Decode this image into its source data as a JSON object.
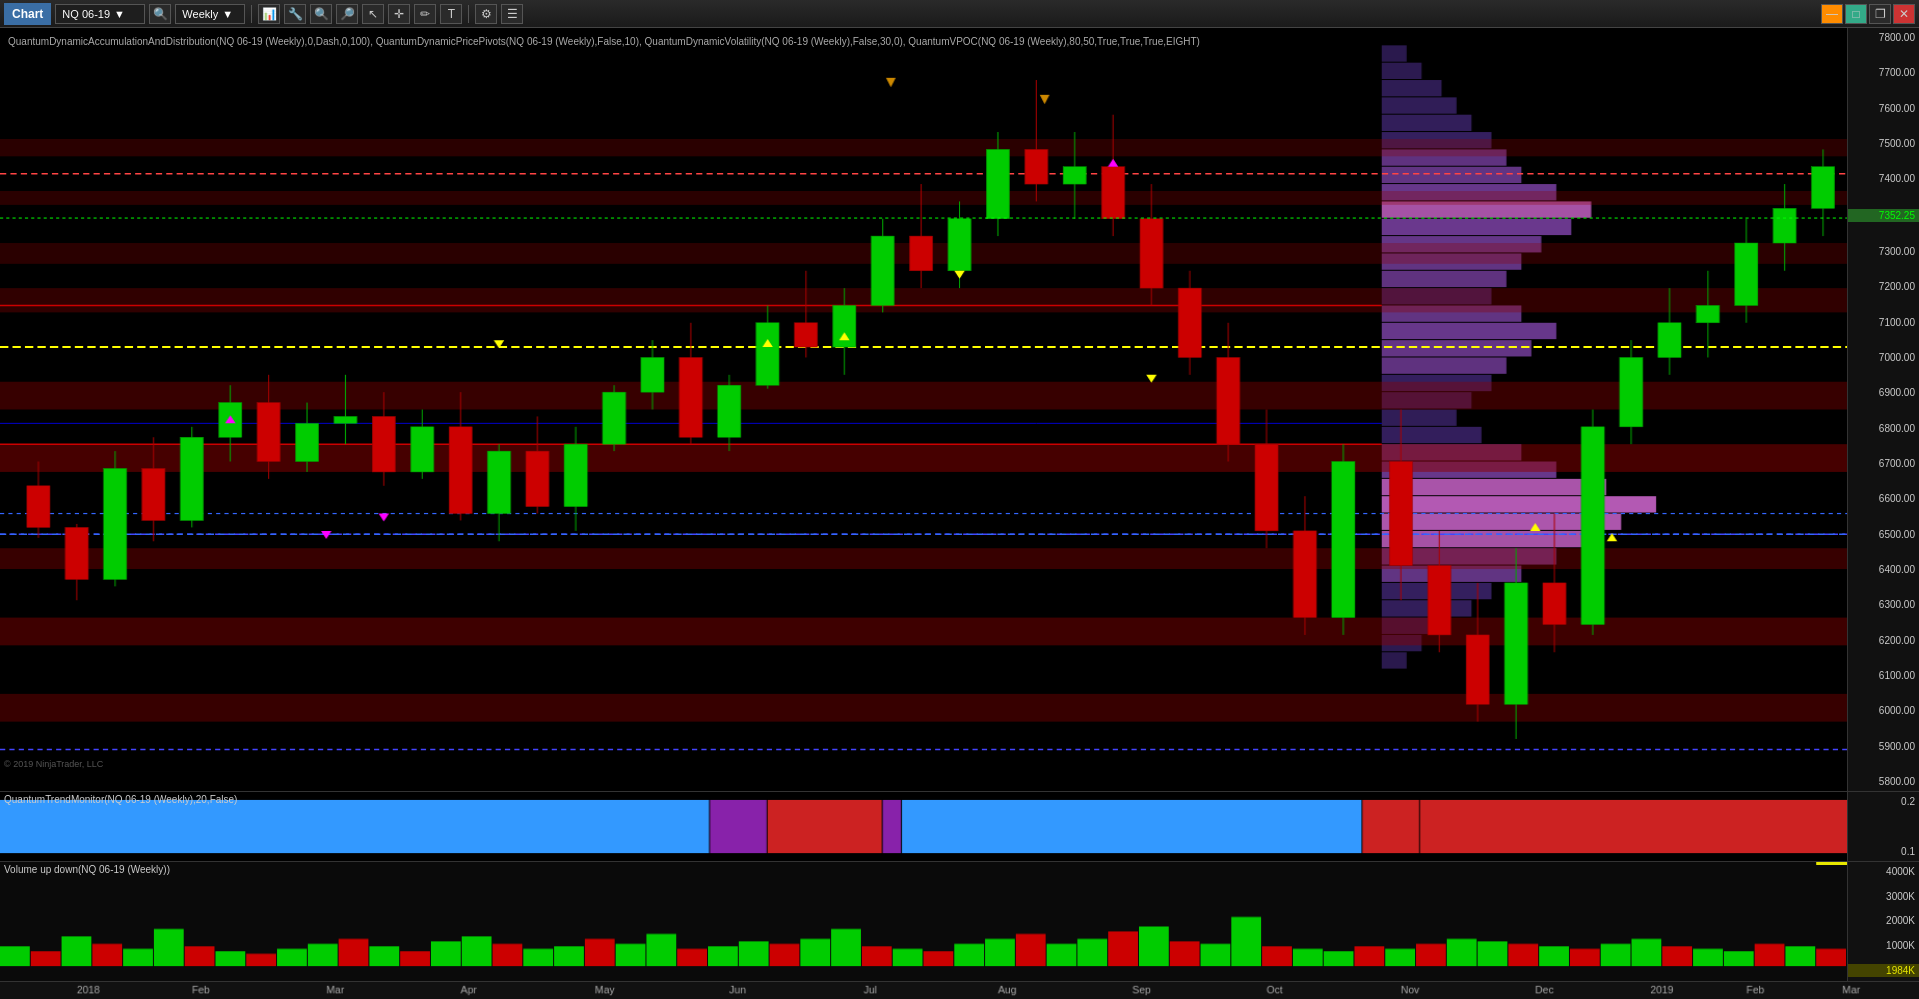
{
  "toolbar": {
    "chart_label": "Chart",
    "symbol": "NQ 06-19",
    "timeframe": "Weekly",
    "buttons": [
      "bar-chart",
      "tools",
      "zoom-in",
      "zoom-out",
      "pointer",
      "crosshair",
      "line",
      "text",
      "settings"
    ]
  },
  "info_label": "QuantumDynamicAccumulationAndDistribution(NQ 06-19 (Weekly),0,Dash,0,100), QuantumDynamicPricePivots(NQ 06-19 (Weekly),False,10), QuantumDynamicVolatility(NQ 06-19 (Weekly),False,30,0), QuantumVPOC(NQ 06-19 (Weekly),80,50,True,True,True,EIGHT)",
  "price_axis": {
    "levels": [
      "7800.00",
      "7700.00",
      "7600.00",
      "7500.00",
      "7400.00",
      "7352.25",
      "7300.00",
      "7200.00",
      "7100.00",
      "7000.00",
      "6900.00",
      "6800.00",
      "6700.00",
      "6600.00",
      "6500.00",
      "6400.00",
      "6300.00",
      "6200.00",
      "6100.00",
      "6000.00",
      "5900.00",
      "5800.00"
    ],
    "current_price": "7352.25"
  },
  "trend_panel": {
    "label": "QuantumTrendMonitor(NQ 06-19 (Weekly),20,False)",
    "axis_values": [
      "0.2",
      "0.1"
    ]
  },
  "volume_panel": {
    "label": "Volume up down(NQ 06-19 (Weekly))",
    "axis_values": [
      "4000K",
      "3000K",
      "2000K",
      "1000K",
      "1984K"
    ]
  },
  "time_axis": {
    "labels": [
      "2018",
      "Feb",
      "Mar",
      "Apr",
      "May",
      "Jun",
      "Jul",
      "Aug",
      "Sep",
      "Oct",
      "Nov",
      "Dec",
      "2019",
      "Feb",
      "Mar"
    ]
  },
  "copyright": "© 2019 NinjaTrader, LLC"
}
